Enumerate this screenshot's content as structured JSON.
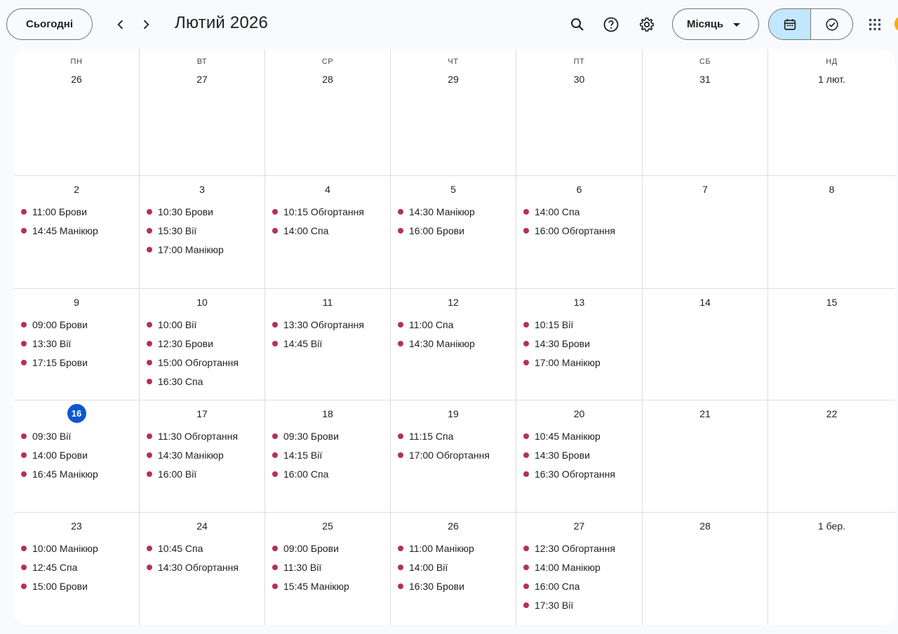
{
  "toolbar": {
    "today_label": "Сьогодні",
    "month_title": "Лютий 2026",
    "view_label": "Місяць",
    "prev_icon": "chevron-left-icon",
    "next_icon": "chevron-right-icon",
    "search_icon": "search-icon",
    "help_icon": "help-icon",
    "settings_icon": "gear-icon",
    "calendar_icon": "calendar-icon",
    "tasks_icon": "tasks-check-icon",
    "apps_icon": "apps-grid-icon"
  },
  "colors": {
    "event_dot": "#b3305e",
    "today_circle": "#0b57d0",
    "selected_segment": "#c2e7ff"
  },
  "weekdays": [
    "ПН",
    "ВТ",
    "СР",
    "ЧТ",
    "ПТ",
    "СБ",
    "НД"
  ],
  "weeks": [
    {
      "days": [
        {
          "label": "26",
          "events": []
        },
        {
          "label": "27",
          "events": []
        },
        {
          "label": "28",
          "events": []
        },
        {
          "label": "29",
          "events": []
        },
        {
          "label": "30",
          "events": []
        },
        {
          "label": "31",
          "events": []
        },
        {
          "label": "1 лют.",
          "events": []
        }
      ]
    },
    {
      "days": [
        {
          "label": "2",
          "events": [
            "11:00 Брови",
            "14:45 Манікюр"
          ]
        },
        {
          "label": "3",
          "events": [
            "10:30 Брови",
            "15:30 Вії",
            "17:00 Манікюр"
          ]
        },
        {
          "label": "4",
          "events": [
            "10:15 Обгортання",
            "14:00 Спа"
          ]
        },
        {
          "label": "5",
          "events": [
            "14:30 Манікюр",
            "16:00 Брови"
          ]
        },
        {
          "label": "6",
          "events": [
            "14:00 Спа",
            "16:00 Обгортання"
          ]
        },
        {
          "label": "7",
          "events": []
        },
        {
          "label": "8",
          "events": []
        }
      ]
    },
    {
      "days": [
        {
          "label": "9",
          "events": [
            "09:00 Брови",
            "13:30 Вії",
            "17:15 Брови"
          ]
        },
        {
          "label": "10",
          "events": [
            "10:00 Вії",
            "12:30 Брови",
            "15:00 Обгортання",
            "16:30 Спа"
          ]
        },
        {
          "label": "11",
          "events": [
            "13:30 Обгортання",
            "14:45 Вії"
          ]
        },
        {
          "label": "12",
          "events": [
            "11:00 Спа",
            "14:30 Манікюр"
          ]
        },
        {
          "label": "13",
          "events": [
            "10:15 Вії",
            "14:30 Брови",
            "17:00 Манікюр"
          ]
        },
        {
          "label": "14",
          "events": []
        },
        {
          "label": "15",
          "events": []
        }
      ]
    },
    {
      "days": [
        {
          "label": "16",
          "today": true,
          "events": [
            "09:30 Вії",
            "14:00 Брови",
            "16:45 Манікюр"
          ]
        },
        {
          "label": "17",
          "events": [
            "11:30 Обгортання",
            "14:30 Манікюр",
            "16:00 Вії"
          ]
        },
        {
          "label": "18",
          "events": [
            "09:30 Брови",
            "14:15 Вії",
            "16:00 Спа"
          ]
        },
        {
          "label": "19",
          "events": [
            "11:15 Спа",
            "17:00 Обгортання"
          ]
        },
        {
          "label": "20",
          "events": [
            "10:45 Манікюр",
            "14:30 Брови",
            "16:30 Обгортання"
          ]
        },
        {
          "label": "21",
          "events": []
        },
        {
          "label": "22",
          "events": []
        }
      ]
    },
    {
      "days": [
        {
          "label": "23",
          "events": [
            "10:00 Манікюр",
            "12:45 Спа",
            "15:00 Брови"
          ]
        },
        {
          "label": "24",
          "events": [
            "10:45 Спа",
            "14:30 Обгортання"
          ]
        },
        {
          "label": "25",
          "events": [
            "09:00 Брови",
            "11:30 Вії",
            "15:45 Манікюр"
          ]
        },
        {
          "label": "26",
          "events": [
            "11:00 Манікюр",
            "14:00 Вії",
            "16:30 Брови"
          ]
        },
        {
          "label": "27",
          "events": [
            "12:30 Обгортання",
            "14:00 Манікюр",
            "16:00 Спа",
            "17:30 Вії"
          ]
        },
        {
          "label": "28",
          "events": []
        },
        {
          "label": "1 бер.",
          "events": []
        }
      ]
    }
  ]
}
